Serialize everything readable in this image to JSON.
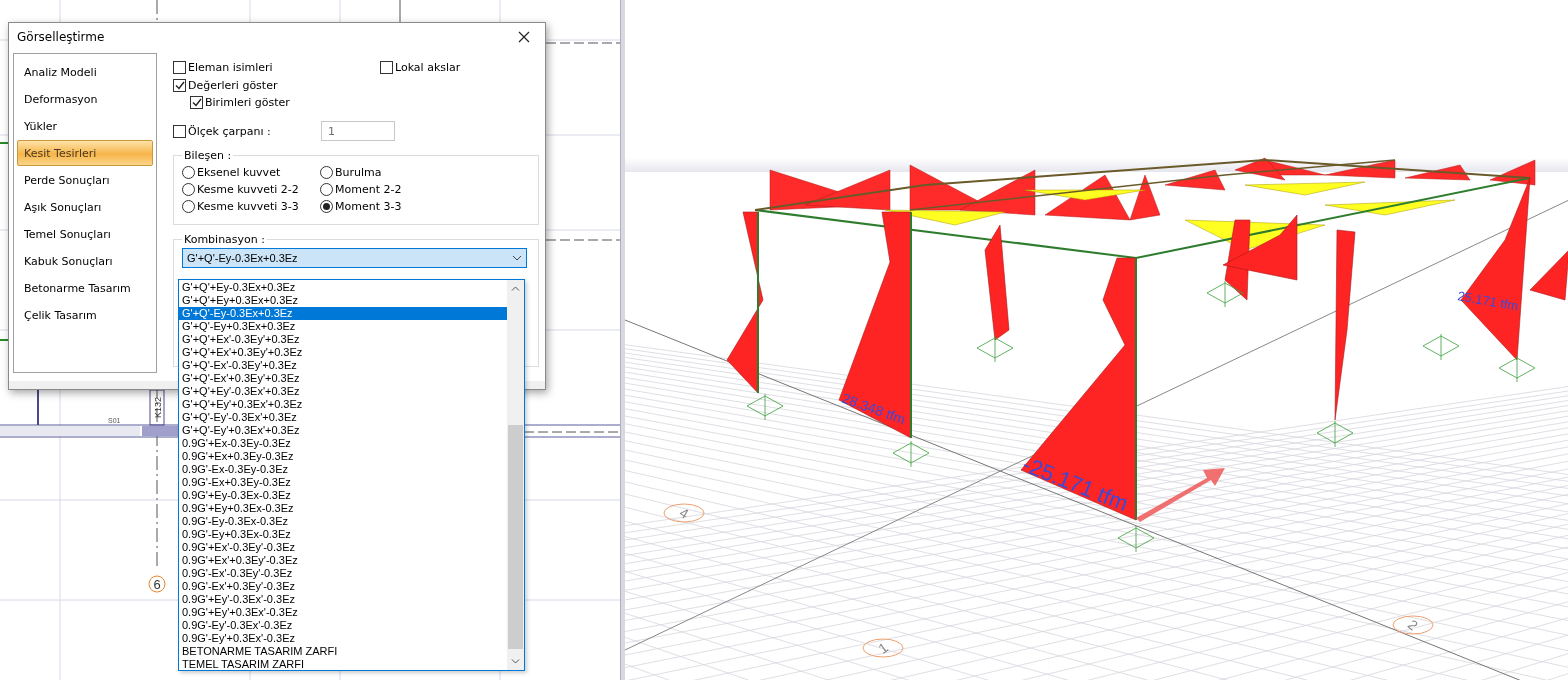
{
  "cad_view": {
    "grid_label": "6",
    "beam_label": "S01",
    "column_label": "K132"
  },
  "dialog": {
    "title": "Görselleştirme",
    "sidebar": {
      "items": [
        {
          "label": "Analiz Modeli",
          "selected": false
        },
        {
          "label": "Deformasyon",
          "selected": false
        },
        {
          "label": "Yükler",
          "selected": false
        },
        {
          "label": "Kesit Tesirleri",
          "selected": true
        },
        {
          "label": "Perde Sonuçları",
          "selected": false
        },
        {
          "label": "Aşık Sonuçları",
          "selected": false
        },
        {
          "label": "Temel Sonuçları",
          "selected": false
        },
        {
          "label": "Kabuk Sonuçları",
          "selected": false
        },
        {
          "label": "Betonarme Tasarım",
          "selected": false
        },
        {
          "label": "Çelik Tasarım",
          "selected": false
        }
      ]
    },
    "options": [
      {
        "label": "Eleman isimleri",
        "checked": false
      },
      {
        "label": "Lokal akslar",
        "checked": false
      },
      {
        "label": "Değerleri göster",
        "checked": true,
        "children": [
          {
            "label": "Birimleri göster",
            "checked": true
          }
        ]
      }
    ],
    "scale": {
      "label": "Ölçek çarpanı :",
      "checked": false,
      "value": "1"
    },
    "component": {
      "title": "Bileşen :",
      "options": [
        {
          "label": "Eksenel kuvvet",
          "selected": false
        },
        {
          "label": "Kesme kuvveti 2-2",
          "selected": false
        },
        {
          "label": "Kesme kuvveti 3-3",
          "selected": false
        },
        {
          "label": "Burulma",
          "selected": false
        },
        {
          "label": "Moment 2-2",
          "selected": false
        },
        {
          "label": "Moment 3-3",
          "selected": true
        }
      ]
    },
    "combination": {
      "title": "Kombinasyon :",
      "value": "G'+Q'-Ey-0.3Ex+0.3Ez",
      "expanded": true,
      "items": [
        {
          "label": "G'+Q'+Ey-0.3Ex+0.3Ez",
          "selected": false
        },
        {
          "label": "G'+Q'+Ey+0.3Ex+0.3Ez",
          "selected": false
        },
        {
          "label": "G'+Q'-Ey-0.3Ex+0.3Ez",
          "selected": true
        },
        {
          "label": "G'+Q'-Ey+0.3Ex+0.3Ez",
          "selected": false
        },
        {
          "label": "G'+Q'+Ex'-0.3Ey'+0.3Ez",
          "selected": false
        },
        {
          "label": "G'+Q'+Ex'+0.3Ey'+0.3Ez",
          "selected": false
        },
        {
          "label": "G'+Q'-Ex'-0.3Ey'+0.3Ez",
          "selected": false
        },
        {
          "label": "G'+Q'-Ex'+0.3Ey'+0.3Ez",
          "selected": false
        },
        {
          "label": "G'+Q'+Ey'-0.3Ex'+0.3Ez",
          "selected": false
        },
        {
          "label": "G'+Q'+Ey'+0.3Ex'+0.3Ez",
          "selected": false
        },
        {
          "label": "G'+Q'-Ey'-0.3Ex'+0.3Ez",
          "selected": false
        },
        {
          "label": "G'+Q'-Ey'+0.3Ex'+0.3Ez",
          "selected": false
        },
        {
          "label": "0.9G'+Ex-0.3Ey-0.3Ez",
          "selected": false
        },
        {
          "label": "0.9G'+Ex+0.3Ey-0.3Ez",
          "selected": false
        },
        {
          "label": "0.9G'-Ex-0.3Ey-0.3Ez",
          "selected": false
        },
        {
          "label": "0.9G'-Ex+0.3Ey-0.3Ez",
          "selected": false
        },
        {
          "label": "0.9G'+Ey-0.3Ex-0.3Ez",
          "selected": false
        },
        {
          "label": "0.9G'+Ey+0.3Ex-0.3Ez",
          "selected": false
        },
        {
          "label": "0.9G'-Ey-0.3Ex-0.3Ez",
          "selected": false
        },
        {
          "label": "0.9G'-Ey+0.3Ex-0.3Ez",
          "selected": false
        },
        {
          "label": "0.9G'+Ex'-0.3Ey'-0.3Ez",
          "selected": false
        },
        {
          "label": "0.9G'+Ex'+0.3Ey'-0.3Ez",
          "selected": false
        },
        {
          "label": "0.9G'-Ex'-0.3Ey'-0.3Ez",
          "selected": false
        },
        {
          "label": "0.9G'-Ex'+0.3Ey'-0.3Ez",
          "selected": false
        },
        {
          "label": "0.9G'+Ey'-0.3Ex'-0.3Ez",
          "selected": false
        },
        {
          "label": "0.9G'+Ey'+0.3Ex'-0.3Ez",
          "selected": false
        },
        {
          "label": "0.9G'-Ey'-0.3Ex'-0.3Ez",
          "selected": false
        },
        {
          "label": "0.9G'-Ey'+0.3Ex'-0.3Ez",
          "selected": false
        },
        {
          "label": "BETONARME TASARIM ZARFI",
          "selected": false
        },
        {
          "label": "TEMEL TASARIM ZARFI",
          "selected": false
        }
      ]
    }
  },
  "model_view": {
    "moment_labels": [
      "-25.171 tfm",
      "28.348 tfm",
      "25.171 tfm"
    ],
    "axis_bubbles": [
      "4",
      "1",
      "2"
    ]
  }
}
